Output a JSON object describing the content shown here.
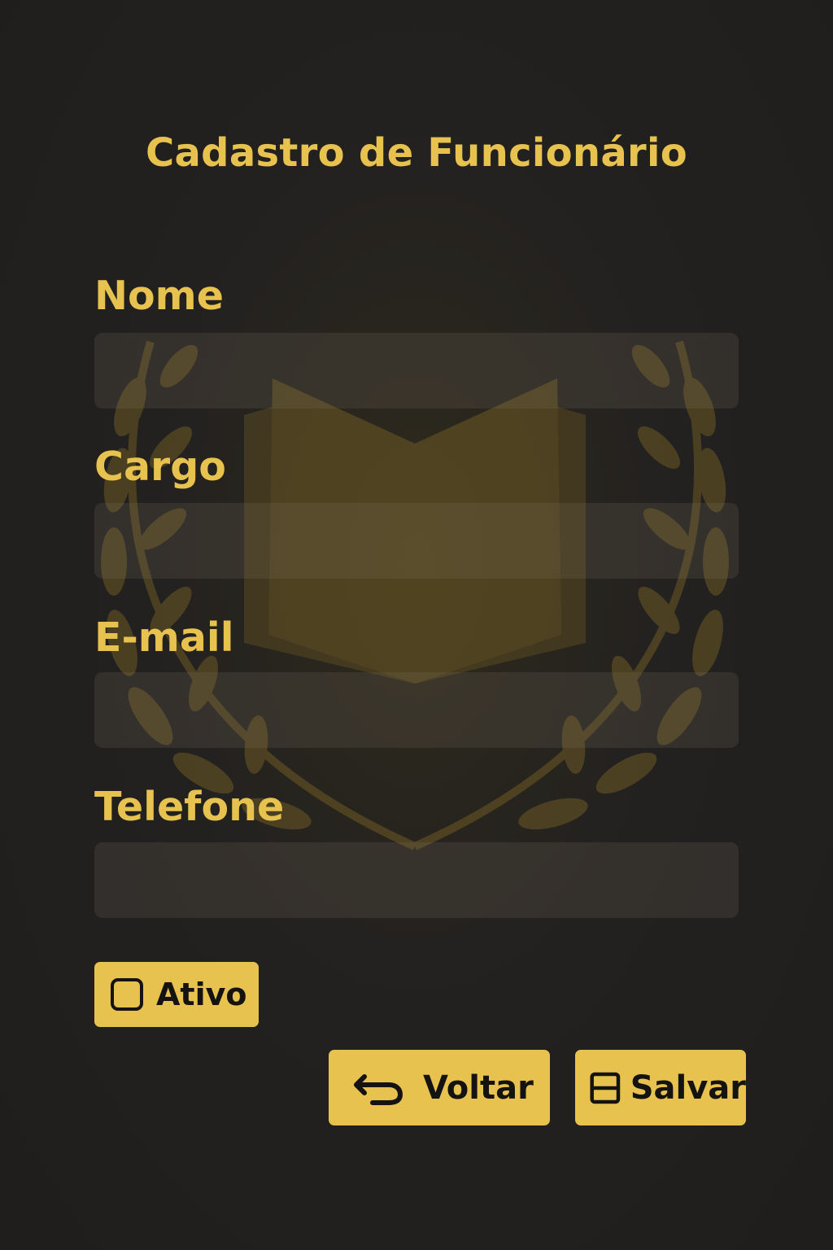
{
  "form": {
    "title": "Cadastro de Funcionário",
    "fields": [
      {
        "label": "Nome",
        "value": "",
        "placeholder": ""
      },
      {
        "label": "Cargo",
        "value": "",
        "placeholder": ""
      },
      {
        "label": "E-mail",
        "value": "",
        "placeholder": ""
      },
      {
        "label": "Telefone",
        "value": "",
        "placeholder": ""
      }
    ],
    "active_checkbox": {
      "label": "Ativo",
      "checked": false
    }
  },
  "actions": {
    "back_label": "Voltar",
    "back_icon": "undo-arrow-icon",
    "save_label": "Salvar",
    "save_icon": "save-icon"
  },
  "colors": {
    "background": "#232120",
    "accent": "#e8c24f",
    "input_fill": "#3a3730",
    "emblem": "#6e5a25"
  },
  "background_emblem": "book-laurel-emblem"
}
